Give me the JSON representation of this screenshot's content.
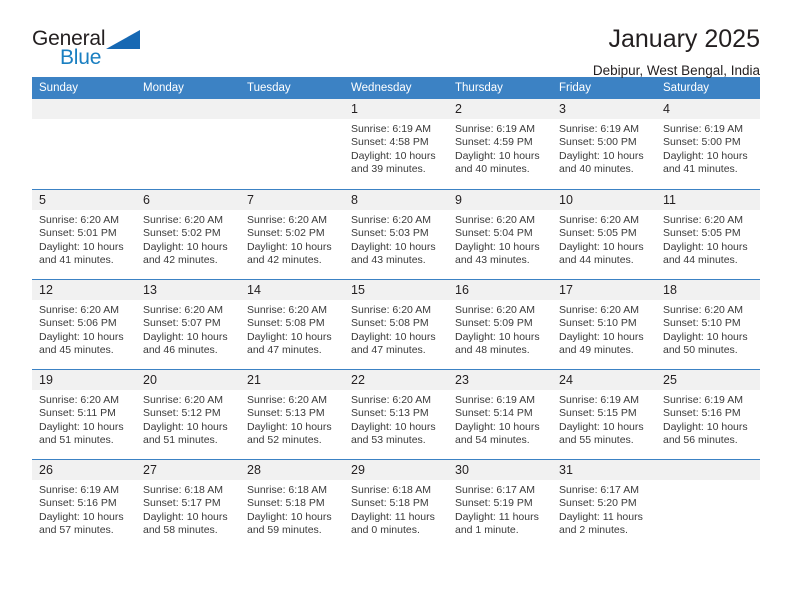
{
  "brand": {
    "name_top": "General",
    "name_bottom": "Blue",
    "triangle_icon": "triangle-icon",
    "accent_color": "#1668b3"
  },
  "header": {
    "title": "January 2025",
    "subtitle": "Debipur, West Bengal, India"
  },
  "theme": {
    "header_row_bg": "#3c82c4",
    "daynum_bg": "#f1f1f1",
    "divider": "#3c82c4",
    "text": "#231f20"
  },
  "calendar": {
    "weekday_headers": [
      "Sunday",
      "Monday",
      "Tuesday",
      "Wednesday",
      "Thursday",
      "Friday",
      "Saturday"
    ],
    "labels": {
      "sunrise": "Sunrise:",
      "sunset": "Sunset:",
      "daylight": "Daylight:"
    },
    "weeks": [
      [
        {
          "day": ""
        },
        {
          "day": ""
        },
        {
          "day": ""
        },
        {
          "day": "1",
          "sunrise": "Sunrise: 6:19 AM",
          "sunset": "Sunset: 4:58 PM",
          "daylight": "Daylight: 10 hours and 39 minutes."
        },
        {
          "day": "2",
          "sunrise": "Sunrise: 6:19 AM",
          "sunset": "Sunset: 4:59 PM",
          "daylight": "Daylight: 10 hours and 40 minutes."
        },
        {
          "day": "3",
          "sunrise": "Sunrise: 6:19 AM",
          "sunset": "Sunset: 5:00 PM",
          "daylight": "Daylight: 10 hours and 40 minutes."
        },
        {
          "day": "4",
          "sunrise": "Sunrise: 6:19 AM",
          "sunset": "Sunset: 5:00 PM",
          "daylight": "Daylight: 10 hours and 41 minutes."
        }
      ],
      [
        {
          "day": "5",
          "sunrise": "Sunrise: 6:20 AM",
          "sunset": "Sunset: 5:01 PM",
          "daylight": "Daylight: 10 hours and 41 minutes."
        },
        {
          "day": "6",
          "sunrise": "Sunrise: 6:20 AM",
          "sunset": "Sunset: 5:02 PM",
          "daylight": "Daylight: 10 hours and 42 minutes."
        },
        {
          "day": "7",
          "sunrise": "Sunrise: 6:20 AM",
          "sunset": "Sunset: 5:02 PM",
          "daylight": "Daylight: 10 hours and 42 minutes."
        },
        {
          "day": "8",
          "sunrise": "Sunrise: 6:20 AM",
          "sunset": "Sunset: 5:03 PM",
          "daylight": "Daylight: 10 hours and 43 minutes."
        },
        {
          "day": "9",
          "sunrise": "Sunrise: 6:20 AM",
          "sunset": "Sunset: 5:04 PM",
          "daylight": "Daylight: 10 hours and 43 minutes."
        },
        {
          "day": "10",
          "sunrise": "Sunrise: 6:20 AM",
          "sunset": "Sunset: 5:05 PM",
          "daylight": "Daylight: 10 hours and 44 minutes."
        },
        {
          "day": "11",
          "sunrise": "Sunrise: 6:20 AM",
          "sunset": "Sunset: 5:05 PM",
          "daylight": "Daylight: 10 hours and 44 minutes."
        }
      ],
      [
        {
          "day": "12",
          "sunrise": "Sunrise: 6:20 AM",
          "sunset": "Sunset: 5:06 PM",
          "daylight": "Daylight: 10 hours and 45 minutes."
        },
        {
          "day": "13",
          "sunrise": "Sunrise: 6:20 AM",
          "sunset": "Sunset: 5:07 PM",
          "daylight": "Daylight: 10 hours and 46 minutes."
        },
        {
          "day": "14",
          "sunrise": "Sunrise: 6:20 AM",
          "sunset": "Sunset: 5:08 PM",
          "daylight": "Daylight: 10 hours and 47 minutes."
        },
        {
          "day": "15",
          "sunrise": "Sunrise: 6:20 AM",
          "sunset": "Sunset: 5:08 PM",
          "daylight": "Daylight: 10 hours and 47 minutes."
        },
        {
          "day": "16",
          "sunrise": "Sunrise: 6:20 AM",
          "sunset": "Sunset: 5:09 PM",
          "daylight": "Daylight: 10 hours and 48 minutes."
        },
        {
          "day": "17",
          "sunrise": "Sunrise: 6:20 AM",
          "sunset": "Sunset: 5:10 PM",
          "daylight": "Daylight: 10 hours and 49 minutes."
        },
        {
          "day": "18",
          "sunrise": "Sunrise: 6:20 AM",
          "sunset": "Sunset: 5:10 PM",
          "daylight": "Daylight: 10 hours and 50 minutes."
        }
      ],
      [
        {
          "day": "19",
          "sunrise": "Sunrise: 6:20 AM",
          "sunset": "Sunset: 5:11 PM",
          "daylight": "Daylight: 10 hours and 51 minutes."
        },
        {
          "day": "20",
          "sunrise": "Sunrise: 6:20 AM",
          "sunset": "Sunset: 5:12 PM",
          "daylight": "Daylight: 10 hours and 51 minutes."
        },
        {
          "day": "21",
          "sunrise": "Sunrise: 6:20 AM",
          "sunset": "Sunset: 5:13 PM",
          "daylight": "Daylight: 10 hours and 52 minutes."
        },
        {
          "day": "22",
          "sunrise": "Sunrise: 6:20 AM",
          "sunset": "Sunset: 5:13 PM",
          "daylight": "Daylight: 10 hours and 53 minutes."
        },
        {
          "day": "23",
          "sunrise": "Sunrise: 6:19 AM",
          "sunset": "Sunset: 5:14 PM",
          "daylight": "Daylight: 10 hours and 54 minutes."
        },
        {
          "day": "24",
          "sunrise": "Sunrise: 6:19 AM",
          "sunset": "Sunset: 5:15 PM",
          "daylight": "Daylight: 10 hours and 55 minutes."
        },
        {
          "day": "25",
          "sunrise": "Sunrise: 6:19 AM",
          "sunset": "Sunset: 5:16 PM",
          "daylight": "Daylight: 10 hours and 56 minutes."
        }
      ],
      [
        {
          "day": "26",
          "sunrise": "Sunrise: 6:19 AM",
          "sunset": "Sunset: 5:16 PM",
          "daylight": "Daylight: 10 hours and 57 minutes."
        },
        {
          "day": "27",
          "sunrise": "Sunrise: 6:18 AM",
          "sunset": "Sunset: 5:17 PM",
          "daylight": "Daylight: 10 hours and 58 minutes."
        },
        {
          "day": "28",
          "sunrise": "Sunrise: 6:18 AM",
          "sunset": "Sunset: 5:18 PM",
          "daylight": "Daylight: 10 hours and 59 minutes."
        },
        {
          "day": "29",
          "sunrise": "Sunrise: 6:18 AM",
          "sunset": "Sunset: 5:18 PM",
          "daylight": "Daylight: 11 hours and 0 minutes."
        },
        {
          "day": "30",
          "sunrise": "Sunrise: 6:17 AM",
          "sunset": "Sunset: 5:19 PM",
          "daylight": "Daylight: 11 hours and 1 minute."
        },
        {
          "day": "31",
          "sunrise": "Sunrise: 6:17 AM",
          "sunset": "Sunset: 5:20 PM",
          "daylight": "Daylight: 11 hours and 2 minutes."
        },
        {
          "day": ""
        }
      ]
    ]
  }
}
